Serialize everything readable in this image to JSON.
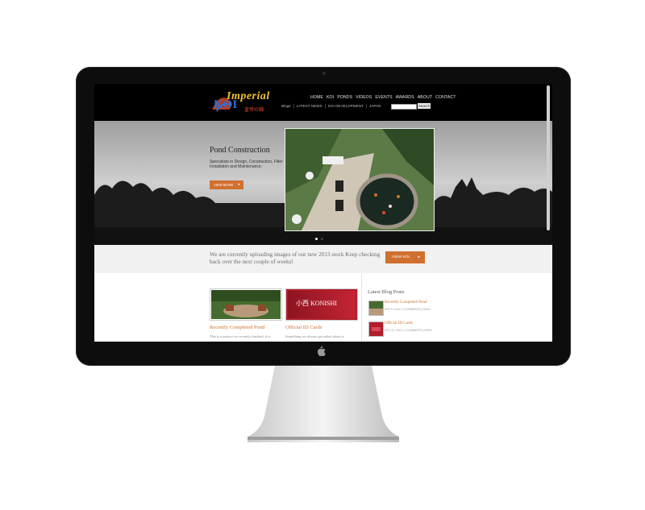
{
  "brand": {
    "logo_text": "Imperial",
    "logo_koi": "KOI",
    "logo_sub": "皇帝の錦",
    "colors": {
      "accent": "#d0702e",
      "header_bg": "#000000",
      "bezel": "#0d0d0d"
    }
  },
  "nav": {
    "main": [
      "HOME",
      "KOI",
      "PONDS",
      "VIDEOS",
      "EVENTS",
      "AWARDS",
      "ABOUT",
      "CONTACT"
    ],
    "sub": [
      "Blogs",
      "|",
      "LATEST NEWS",
      "|",
      "KOI DEVELOPMENT",
      "|",
      "JAPAN"
    ],
    "search_button": "Search"
  },
  "hero": {
    "title": "Pond Construction",
    "description": "Specialists in Design, Construction, Filter Installation and Maintenance.",
    "button": "VIEW MORE"
  },
  "notice": {
    "text": "We are currently uploading images of our new 2013 stock Keep checking back over the next couple of weeks!",
    "button": "VIEW KOI"
  },
  "posts": [
    {
      "title": "Recently Completed Pond",
      "excerpt": "This is a project we recently finished, it is",
      "thumb_icon": "pond-photo"
    },
    {
      "title": "Official ID Cards",
      "excerpt": "Something we always get asked about is",
      "thumb_icon": "konishi-card",
      "thumb_text": "小西 KONISHI"
    }
  ],
  "sidebar": {
    "title": "Latest Blog Posts",
    "items": [
      {
        "title": "Recently Completed Pond",
        "meta": "APR 9, 2013 | 0 COMMENTS | READ"
      },
      {
        "title": "Official ID Cards",
        "meta": "DEC 21, 2012 | 0 COMMENTS | READ"
      }
    ]
  },
  "hero_arrow": "▸",
  "notice_arrow": "▸"
}
